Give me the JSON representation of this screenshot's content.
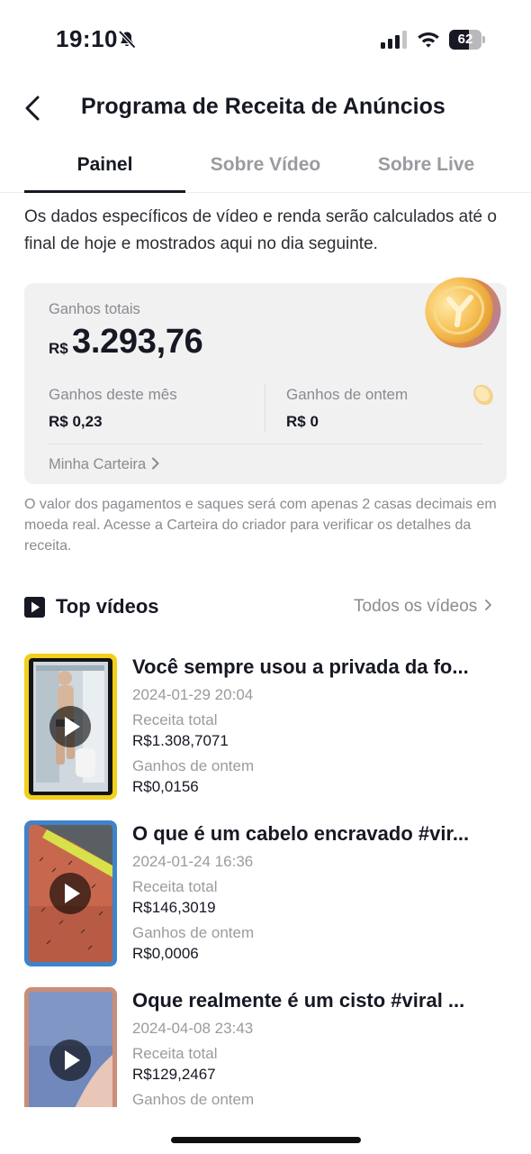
{
  "status_bar": {
    "time": "19:10",
    "battery": "62",
    "battery_level": 0.62,
    "icons": [
      "bell-slash-icon",
      "cellular-signal-icon",
      "wifi-icon",
      "battery-icon"
    ]
  },
  "header": {
    "title": "Programa de Receita de Anúncios",
    "back_icon": "chevron-left-icon"
  },
  "tabs": [
    {
      "label": "Painel",
      "active": true
    },
    {
      "label": "Sobre Vídeo",
      "active": false
    },
    {
      "label": "Sobre Live",
      "active": false
    }
  ],
  "intro_text": "Os dados específicos de vídeo e renda serão calculados até o final de hoje e mostrados aqui no dia seguinte.",
  "earnings": {
    "total_label": "Ganhos totais",
    "currency": "R$",
    "total_value": "3.293,76",
    "month_label": "Ganhos deste mês",
    "month_value": "R$ 0,23",
    "yesterday_label": "Ganhos de ontem",
    "yesterday_value": "R$ 0",
    "wallet_link": "Minha Carteira"
  },
  "notice_text": "O valor dos pagamentos e saques será com apenas 2 casas decimais em moeda real. Acesse a Carteira do criador para verificar os detalhes da receita.",
  "top_videos": {
    "title": "Top vídeos",
    "all_link": "Todos os vídeos",
    "items": [
      {
        "title": "Você sempre usou a privada da fo...",
        "date": "2024-01-29 20:04",
        "revenue_label": "Receita total",
        "revenue": "R$1.308,7071",
        "yesterday_label": "Ganhos de ontem",
        "yesterday": "R$0,0156"
      },
      {
        "title": "O que é um cabelo encravado #vir...",
        "date": "2024-01-24 16:36",
        "revenue_label": "Receita total",
        "revenue": "R$146,3019",
        "yesterday_label": "Ganhos de ontem",
        "yesterday": "R$0,0006"
      },
      {
        "title": "Oque realmente é um cisto #viral ...",
        "date": "2024-04-08 23:43",
        "revenue_label": "Receita total",
        "revenue": "R$129,2467",
        "yesterday_label": "Ganhos de ontem"
      }
    ]
  },
  "colors": {
    "text_primary": "#161823",
    "text_secondary": "#8a8b91",
    "card_background": "#f1f1f2",
    "thumb_border_1": "#f3cf1c",
    "thumb_border_2": "#3f83c9",
    "thumb_border_3": "#c98d78"
  }
}
